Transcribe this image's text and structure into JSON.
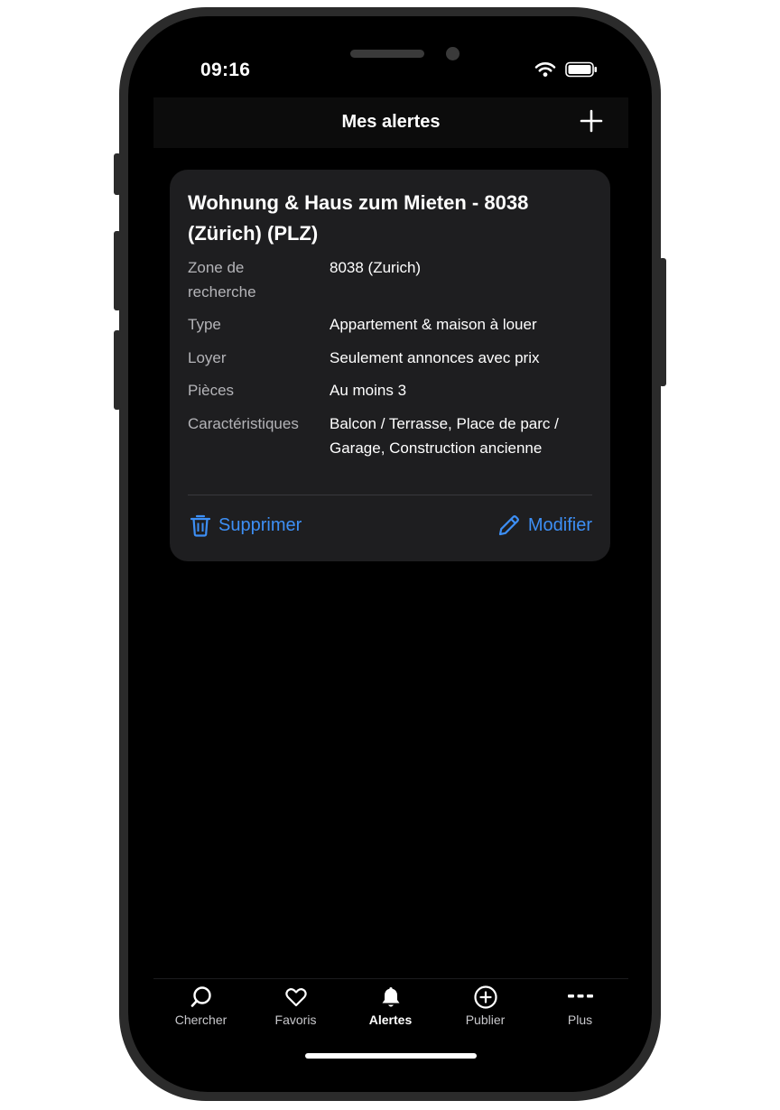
{
  "status_bar": {
    "time": "09:16",
    "icons": [
      "wifi-icon",
      "battery-icon"
    ]
  },
  "header": {
    "title": "Mes alertes",
    "add_icon": "plus-icon"
  },
  "alert": {
    "title": "Wohnung & Haus zum Mieten - 8038 (Zürich) (PLZ)",
    "rows": [
      {
        "label": "Zone de recherche",
        "value": "8038 (Zurich)"
      },
      {
        "label": "Type",
        "value": "Appartement & maison à louer"
      },
      {
        "label": "Loyer",
        "value": "Seulement annonces avec prix"
      },
      {
        "label": "Pièces",
        "value": "Au moins 3"
      },
      {
        "label": "Caractéristiques",
        "value": "Balcon / Terrasse, Place de parc / Garage, Construction ancienne"
      }
    ],
    "delete_label": "Supprimer",
    "edit_label": "Modifier"
  },
  "tabbar": {
    "items": [
      {
        "label": "Chercher",
        "icon": "search-icon",
        "active": false
      },
      {
        "label": "Favoris",
        "icon": "heart-icon",
        "active": false
      },
      {
        "label": "Alertes",
        "icon": "bell-icon",
        "active": true
      },
      {
        "label": "Publier",
        "icon": "plus-circle-icon",
        "active": false
      },
      {
        "label": "Plus",
        "icon": "more-icon",
        "active": false
      }
    ]
  },
  "colors": {
    "accent": "#3d8ff5",
    "background": "#000000",
    "card": "#1e1e20"
  }
}
